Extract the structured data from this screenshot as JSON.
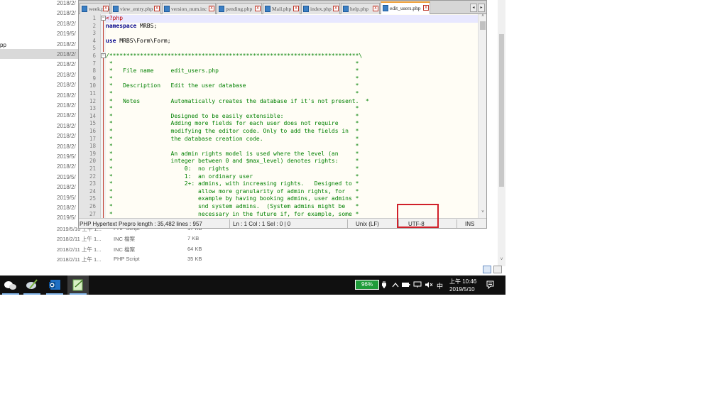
{
  "explorer": {
    "left_labels": [
      "pp",
      " ",
      " "
    ],
    "date_column": [
      "2018/2/",
      "2018/2/",
      "2018/2/",
      "2019/5/",
      "2018/2/",
      "2018/2/",
      "2018/2/",
      "2018/2/",
      "2018/2/",
      "2018/2/",
      "2018/2/",
      "2018/2/",
      "2018/2/",
      "2018/2/",
      "2018/2/",
      "2019/5/",
      "2018/2/",
      "2019/5/",
      "2018/2/",
      "2019/5/",
      "2018/2/",
      "2019/5/"
    ],
    "rows": [
      {
        "date": "2019/5/10 上午 1...",
        "type": "PHP Script",
        "size": "17 KB"
      },
      {
        "date": "2018/2/11 上午 1...",
        "type": "INC 檔案",
        "size": "7 KB"
      },
      {
        "date": "2018/2/11 上午 1...",
        "type": "INC 檔案",
        "size": "64 KB"
      },
      {
        "date": "2018/2/11 上午 1...",
        "type": "PHP Script",
        "size": "35 KB"
      }
    ],
    "scroll_arrow": "˅"
  },
  "npp": {
    "tabs": [
      {
        "label": "week.php",
        "active": false
      },
      {
        "label": "view_entry.php",
        "active": false
      },
      {
        "label": "version_num.inc",
        "active": false
      },
      {
        "label": "pending.php",
        "active": false
      },
      {
        "label": "Mail.php",
        "active": false
      },
      {
        "label": "index.php",
        "active": false
      },
      {
        "label": "help.php",
        "active": false
      },
      {
        "label": "edit_users.php",
        "active": true
      }
    ],
    "tab_close": "x",
    "tab_nav_left": "◂",
    "tab_nav_right": "▸",
    "fold_minus": "−",
    "scroll_up": "˄",
    "scroll_down": "˅",
    "lines": [
      {
        "n": "1",
        "segments": [
          {
            "t": "<?php",
            "c": "tag"
          }
        ]
      },
      {
        "n": "2",
        "segments": [
          {
            "t": "namespace",
            "c": "kw"
          },
          {
            "t": " MRBS;",
            "c": "plain"
          }
        ]
      },
      {
        "n": "3",
        "segments": []
      },
      {
        "n": "4",
        "segments": [
          {
            "t": "use",
            "c": "kw"
          },
          {
            "t": " MRBS\\Form\\Form;",
            "c": "plain"
          }
        ]
      },
      {
        "n": "5",
        "segments": []
      },
      {
        "n": "6",
        "segments": [
          {
            "t": "/*************************************************************************\\",
            "c": "com"
          }
        ]
      },
      {
        "n": "7",
        "segments": [
          {
            "t": " *                                                                       *",
            "c": "com"
          }
        ]
      },
      {
        "n": "8",
        "segments": [
          {
            "t": " *   File name     edit_users.php                                        *",
            "c": "com"
          }
        ]
      },
      {
        "n": "9",
        "segments": [
          {
            "t": " *                                                                       *",
            "c": "com"
          }
        ]
      },
      {
        "n": "10",
        "segments": [
          {
            "t": " *   Description   Edit the user database                                *",
            "c": "com"
          }
        ]
      },
      {
        "n": "11",
        "segments": [
          {
            "t": " *                                                                       *",
            "c": "com"
          }
        ]
      },
      {
        "n": "12",
        "segments": [
          {
            "t": " *   Notes         Automatically creates the database if it's not present.  *",
            "c": "com"
          }
        ]
      },
      {
        "n": "13",
        "segments": [
          {
            "t": " *                                                                       *",
            "c": "com"
          }
        ]
      },
      {
        "n": "14",
        "segments": [
          {
            "t": " *                 Designed to be easily extensible:                     *",
            "c": "com"
          }
        ]
      },
      {
        "n": "15",
        "segments": [
          {
            "t": " *                 Adding more fields for each user does not require     *",
            "c": "com"
          }
        ]
      },
      {
        "n": "16",
        "segments": [
          {
            "t": " *                 modifying the editor code. Only to add the fields in  *",
            "c": "com"
          }
        ]
      },
      {
        "n": "17",
        "segments": [
          {
            "t": " *                 the database creation code.                           *",
            "c": "com"
          }
        ]
      },
      {
        "n": "18",
        "segments": [
          {
            "t": " *                                                                       *",
            "c": "com"
          }
        ]
      },
      {
        "n": "19",
        "segments": [
          {
            "t": " *                 An admin rights model is used where the level (an     *",
            "c": "com"
          }
        ]
      },
      {
        "n": "20",
        "segments": [
          {
            "t": " *                 integer between 0 and $max_level) denotes rights:     *",
            "c": "com"
          }
        ]
      },
      {
        "n": "21",
        "segments": [
          {
            "t": " *                     0:  no rights                                     *",
            "c": "com"
          }
        ]
      },
      {
        "n": "22",
        "segments": [
          {
            "t": " *                     1:  an ordinary user                              *",
            "c": "com"
          }
        ]
      },
      {
        "n": "23",
        "segments": [
          {
            "t": " *                     2+: admins, with increasing rights.   Designed to *",
            "c": "com"
          }
        ]
      },
      {
        "n": "24",
        "segments": [
          {
            "t": " *                         allow more granularity of admin rights, for   *",
            "c": "com"
          }
        ]
      },
      {
        "n": "25",
        "segments": [
          {
            "t": " *                         example by having booking admins, user admins *",
            "c": "com"
          }
        ]
      },
      {
        "n": "26",
        "segments": [
          {
            "t": " *                         snd system admins.  (System admins might be   *",
            "c": "com"
          }
        ]
      },
      {
        "n": "27",
        "segments": [
          {
            "t": " *                         necessary in the future if, for example, some *",
            "c": "com"
          }
        ]
      }
    ],
    "status": {
      "file_info": "PHP Hypertext Prepro length : 35,482   lines : 957",
      "position": "Ln : 1    Col : 1    Sel : 0 | 0",
      "eol": "Unix (LF)",
      "encoding": "UTF-8",
      "mode": "INS"
    }
  },
  "taskbar": {
    "battery": "96%",
    "ime": "中",
    "time": "上午 10:46",
    "date": "2019/5/10",
    "tray_icons": [
      "power-plug-icon",
      "chevron-up-icon",
      "battery-status-icon",
      "network-icon",
      "volume-muted-icon"
    ],
    "apps": [
      "wechat-icon",
      "paint-icon",
      "outlook-icon",
      "notepadpp-icon"
    ]
  },
  "colors": {
    "comment": "#008000",
    "keyword": "#00008b",
    "php_tag": "#c00000",
    "highlight_box": "#d0202a",
    "battery": "#1f9c3a"
  }
}
